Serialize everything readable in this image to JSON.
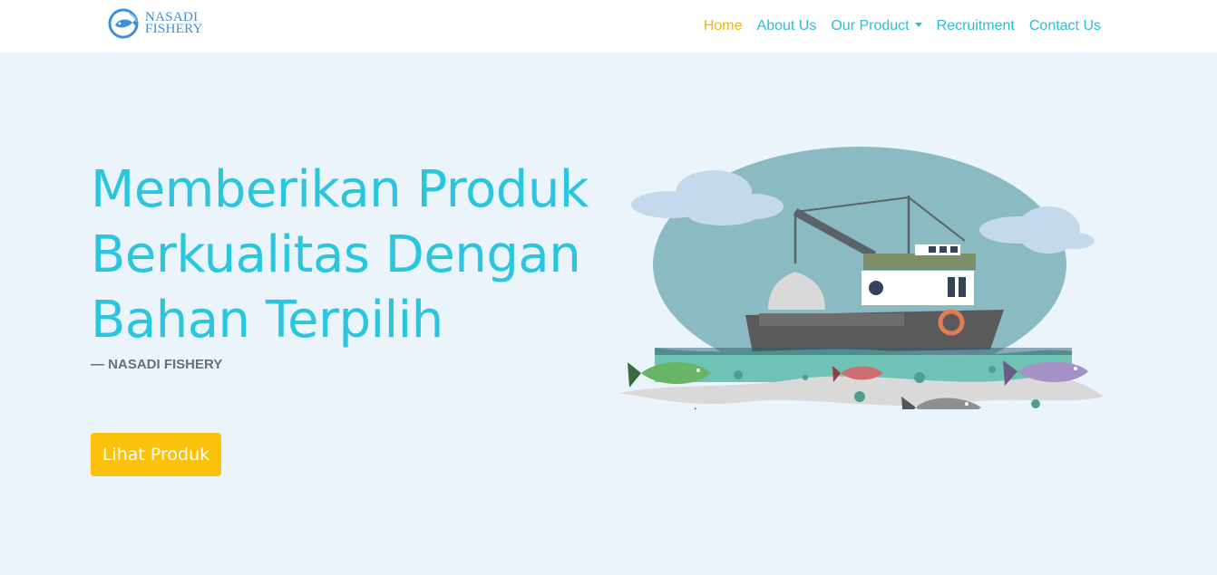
{
  "brand": {
    "line1": "NASADI",
    "line2": "FISHERY",
    "logo_icon": "fish-circle-logo",
    "color": "#3d8fd8"
  },
  "nav": {
    "items": [
      {
        "label": "Home",
        "active": true
      },
      {
        "label": "About Us"
      },
      {
        "label": "Our Product",
        "dropdown": true
      },
      {
        "label": "Recruitment"
      },
      {
        "label": "Contact Us"
      }
    ],
    "link_color": "#2bbdd6",
    "active_color": "#f5b400"
  },
  "hero": {
    "title": "Memberikan Produk Berkualitas Dengan Bahan Terpilih",
    "attribution": "— NASADI FISHERY",
    "button_label": "Lihat Produk",
    "title_color": "#2ac6df",
    "button_color": "#fcc10b",
    "background": "#ebf4fb",
    "illustration": "fishing-boat-with-fish-illustration"
  }
}
